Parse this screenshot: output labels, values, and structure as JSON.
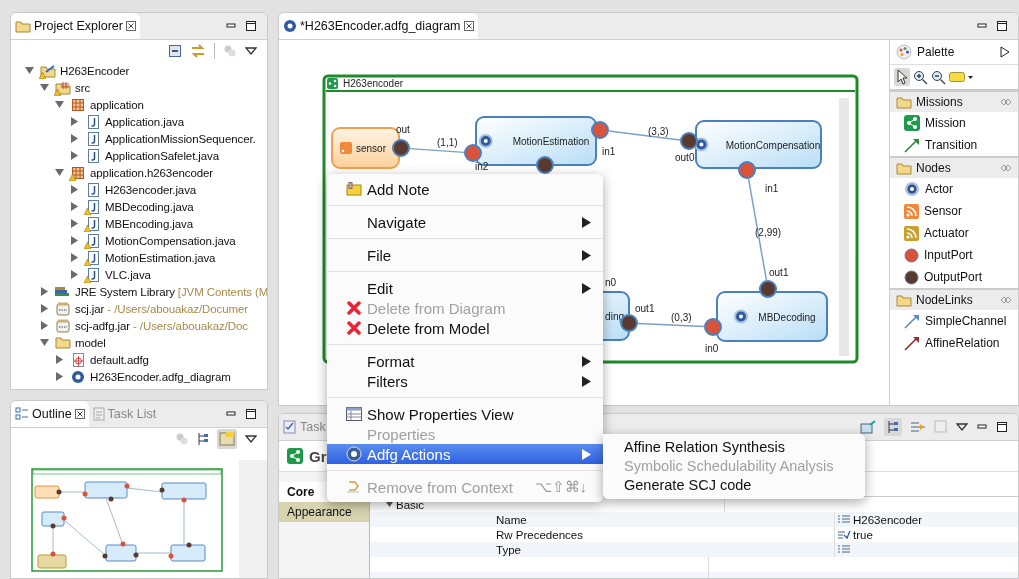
{
  "explorer": {
    "tab": {
      "title": "Project Explorer",
      "selected": true
    },
    "tree": [
      {
        "label": "H263Encoder",
        "kind": "project",
        "warning": true,
        "expanded": true,
        "children": [
          {
            "label": "src",
            "kind": "srcfolder",
            "warning": true,
            "expanded": true,
            "children": [
              {
                "label": "application",
                "kind": "package",
                "warning": false,
                "expanded": true,
                "children": [
                  {
                    "label": "Application.java",
                    "kind": "java",
                    "warning": false,
                    "expanded": false
                  },
                  {
                    "label": "ApplicationMissionSequencer.",
                    "kind": "java",
                    "warning": false,
                    "expanded": false
                  },
                  {
                    "label": "ApplicationSafelet.java",
                    "kind": "java",
                    "warning": false,
                    "expanded": false
                  }
                ]
              },
              {
                "label": "application.h263encoder",
                "kind": "package",
                "warning": true,
                "expanded": true,
                "children": [
                  {
                    "label": "H263encoder.java",
                    "kind": "java",
                    "warning": false,
                    "expanded": false
                  },
                  {
                    "label": "MBDecoding.java",
                    "kind": "java",
                    "warning": true,
                    "expanded": false
                  },
                  {
                    "label": "MBEncoding.java",
                    "kind": "java",
                    "warning": true,
                    "expanded": false
                  },
                  {
                    "label": "MotionCompensation.java",
                    "kind": "java",
                    "warning": true,
                    "expanded": false
                  },
                  {
                    "label": "MotionEstimation.java",
                    "kind": "java",
                    "warning": true,
                    "expanded": false
                  },
                  {
                    "label": "VLC.java",
                    "kind": "java",
                    "warning": true,
                    "expanded": false
                  }
                ]
              }
            ]
          },
          {
            "label": "JRE System Library",
            "detail": "[JVM Contents (M",
            "kind": "library",
            "warning": false,
            "expanded": false
          },
          {
            "label": "scj.jar",
            "detail": "- /Users/abouakaz/Documer",
            "kind": "jar",
            "warning": false,
            "expanded": false
          },
          {
            "label": "scj-adfg.jar",
            "detail": "- /Users/abouakaz/Doc",
            "kind": "jar",
            "warning": false,
            "expanded": false
          },
          {
            "label": "model",
            "kind": "folder",
            "warning": false,
            "expanded": true,
            "children": [
              {
                "label": "default.adfg",
                "kind": "adfg",
                "warning": false,
                "expanded": false
              },
              {
                "label": "H263Encoder.adfg_diagram",
                "kind": "diagram",
                "warning": false,
                "expanded": false
              }
            ]
          }
        ]
      }
    ]
  },
  "outline": {
    "tabs": [
      {
        "title": "Outline",
        "selected": true
      },
      {
        "title": "Task List",
        "selected": false
      }
    ]
  },
  "editor": {
    "tab": {
      "title": "*H263Encoder.adfg_diagram",
      "selected": true
    },
    "diagram": {
      "title": "H263encoder",
      "nodes": [
        {
          "label": "sensor",
          "kind": "sensor"
        },
        {
          "label": "MotionEstimation",
          "kind": "actor"
        },
        {
          "label": "MotionCompensation",
          "kind": "actor"
        },
        {
          "label": "ding",
          "kind": "actor"
        },
        {
          "label": "MBDecoding",
          "kind": "actor"
        }
      ],
      "ports": [
        {
          "label": "out",
          "kind": "output"
        },
        {
          "label": "in2",
          "kind": "input"
        },
        {
          "kind": "output"
        },
        {
          "label": "in1",
          "kind": "input"
        },
        {
          "label": "out0",
          "kind": "output"
        },
        {
          "label": "in1",
          "kind": "input"
        },
        {
          "label": "out1",
          "kind": "output"
        },
        {
          "label": "in0",
          "kind": "input"
        },
        {
          "label": "out1",
          "kind": "output"
        },
        {
          "label": "n0",
          "kind": "input"
        }
      ],
      "channels": [
        {
          "label": "(1,1)"
        },
        {
          "label": "(3,3)"
        },
        {
          "label": "(2,99)"
        },
        {
          "label": "(0,3)"
        }
      ]
    },
    "palette": {
      "title": "Palette",
      "groups": [
        {
          "title": "Missions",
          "expanded": true,
          "items": [
            {
              "label": "Mission",
              "kind": "mission"
            },
            {
              "label": "Transition",
              "kind": "transition"
            }
          ]
        },
        {
          "title": "Nodes",
          "expanded": true,
          "items": [
            {
              "label": "Actor",
              "kind": "actor"
            },
            {
              "label": "Sensor",
              "kind": "sensor"
            },
            {
              "label": "Actuator",
              "kind": "actuator"
            },
            {
              "label": "InputPort",
              "kind": "input"
            },
            {
              "label": "OutputPort",
              "kind": "output"
            }
          ]
        },
        {
          "title": "NodeLinks",
          "expanded": true,
          "items": [
            {
              "label": "SimpleChannel",
              "kind": "channel"
            },
            {
              "label": "AffineRelation",
              "kind": "affine"
            }
          ]
        }
      ]
    }
  },
  "bottom": {
    "tab": {
      "title": "Task"
    },
    "header": "Gr",
    "side_tabs": [
      {
        "label": "Core",
        "selected": true
      },
      {
        "label": "Appearance",
        "selected": false
      }
    ],
    "groups": [
      {
        "label": "Basic",
        "expanded": true,
        "rows": [
          {
            "name": "Name",
            "value": "H263encoder",
            "kind": "text"
          },
          {
            "name": "Rw Precedences",
            "value": "true",
            "kind": "bool"
          },
          {
            "name": "Type",
            "kind": "text"
          }
        ]
      }
    ]
  },
  "context_menu": {
    "groups": [
      [
        {
          "label": "Add Note",
          "kind": "note",
          "submenu": false,
          "disabled": false,
          "selected": false
        }
      ],
      [
        {
          "label": "Navigate",
          "submenu": true,
          "disabled": false,
          "selected": false
        }
      ],
      [
        {
          "label": "File",
          "submenu": true,
          "disabled": false,
          "selected": false
        }
      ],
      [
        {
          "label": "Edit",
          "submenu": true,
          "disabled": false,
          "selected": false
        },
        {
          "label": "Delete from Diagram",
          "kind": "delete",
          "submenu": false,
          "disabled": true,
          "selected": false
        },
        {
          "label": "Delete from Model",
          "kind": "delete",
          "submenu": false,
          "disabled": false,
          "selected": false
        }
      ],
      [
        {
          "label": "Format",
          "submenu": true,
          "disabled": false,
          "selected": false
        },
        {
          "label": "Filters",
          "submenu": true,
          "disabled": false,
          "selected": false
        }
      ],
      [
        {
          "label": "Show Properties View",
          "kind": "table",
          "submenu": false,
          "disabled": false,
          "selected": false
        },
        {
          "label": "Properties",
          "submenu": false,
          "disabled": true,
          "selected": false
        },
        {
          "label": "Adfg Actions",
          "kind": "gear",
          "submenu": true,
          "disabled": false,
          "selected": true
        }
      ],
      [
        {
          "label": "Remove from Context",
          "kind": "remove",
          "shortcut": "⌥⇧⌘↓",
          "submenu": false,
          "disabled": true,
          "selected": false
        }
      ]
    ],
    "submenu": [
      {
        "label": "Affine Relation Synthesis",
        "disabled": false
      },
      {
        "label": "Symbolic Schedulability Analysis",
        "disabled": true
      },
      {
        "label": "Generate SCJ code",
        "disabled": false
      }
    ]
  }
}
